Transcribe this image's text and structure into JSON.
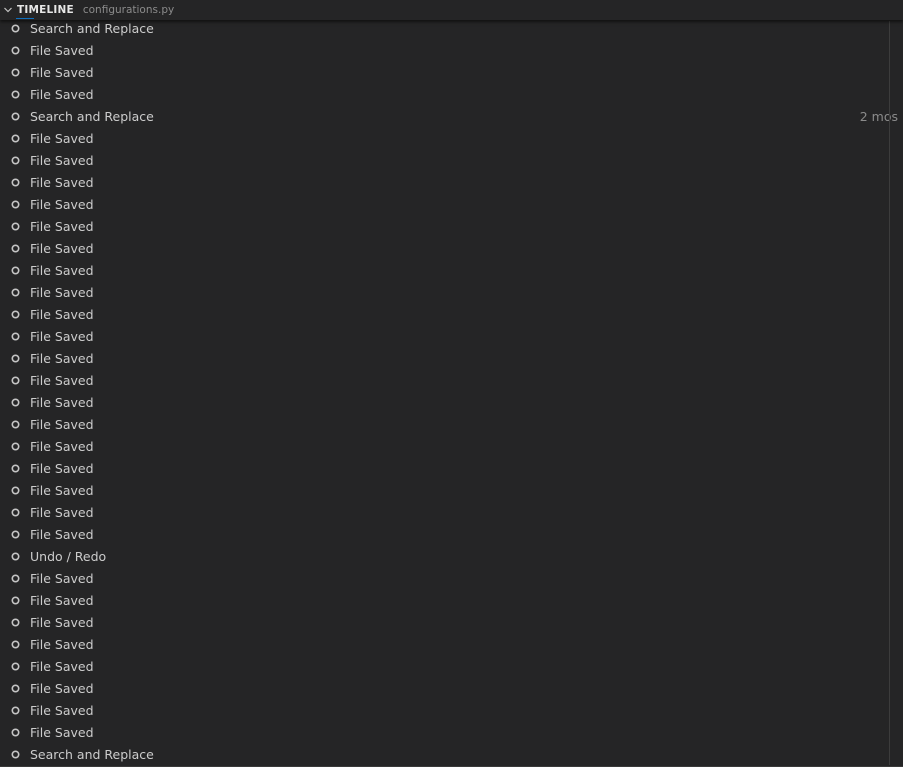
{
  "header": {
    "title": "TIMELINE",
    "subtitle": "configurations.py",
    "chevron_icon": "chevron-down-icon"
  },
  "colors": {
    "background": "#252526",
    "text": "#cccccc",
    "muted": "#8b8b8b",
    "accent": "#0e70c0"
  },
  "items": [
    {
      "label": "Search and Replace",
      "time": ""
    },
    {
      "label": "File Saved",
      "time": ""
    },
    {
      "label": "File Saved",
      "time": ""
    },
    {
      "label": "File Saved",
      "time": ""
    },
    {
      "label": "Search and Replace",
      "time": "2 mos"
    },
    {
      "label": "File Saved",
      "time": ""
    },
    {
      "label": "File Saved",
      "time": ""
    },
    {
      "label": "File Saved",
      "time": ""
    },
    {
      "label": "File Saved",
      "time": ""
    },
    {
      "label": "File Saved",
      "time": ""
    },
    {
      "label": "File Saved",
      "time": ""
    },
    {
      "label": "File Saved",
      "time": ""
    },
    {
      "label": "File Saved",
      "time": ""
    },
    {
      "label": "File Saved",
      "time": ""
    },
    {
      "label": "File Saved",
      "time": ""
    },
    {
      "label": "File Saved",
      "time": ""
    },
    {
      "label": "File Saved",
      "time": ""
    },
    {
      "label": "File Saved",
      "time": ""
    },
    {
      "label": "File Saved",
      "time": ""
    },
    {
      "label": "File Saved",
      "time": ""
    },
    {
      "label": "File Saved",
      "time": ""
    },
    {
      "label": "File Saved",
      "time": ""
    },
    {
      "label": "File Saved",
      "time": ""
    },
    {
      "label": "File Saved",
      "time": ""
    },
    {
      "label": "Undo / Redo",
      "time": ""
    },
    {
      "label": "File Saved",
      "time": ""
    },
    {
      "label": "File Saved",
      "time": ""
    },
    {
      "label": "File Saved",
      "time": ""
    },
    {
      "label": "File Saved",
      "time": ""
    },
    {
      "label": "File Saved",
      "time": ""
    },
    {
      "label": "File Saved",
      "time": ""
    },
    {
      "label": "File Saved",
      "time": ""
    },
    {
      "label": "File Saved",
      "time": ""
    },
    {
      "label": "Search and Replace",
      "time": ""
    }
  ],
  "item_icon": "circle-outline-icon"
}
